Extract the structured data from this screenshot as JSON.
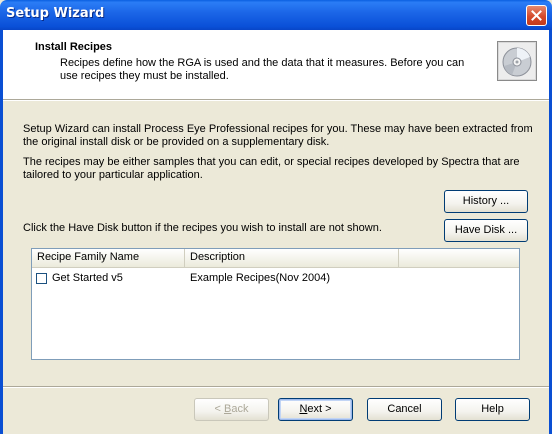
{
  "window": {
    "title": "Setup Wizard"
  },
  "header": {
    "title": "Install Recipes",
    "description": "Recipes define how the RGA is used and the data that it measures.  Before you can use recipes they must be installed."
  },
  "body": {
    "para1": "Setup Wizard can install Process Eye Professional recipes for you.  These may have been extracted from the original install disk or be provided on a supplementary disk.",
    "para2": "The recipes may be either samples that you can edit, or special recipes developed by Spectra that are tailored to your particular application.",
    "para3": "Click the Have Disk button if the recipes you wish to install are not shown."
  },
  "buttons": {
    "history": "History ...",
    "have_disk": "Have Disk ...",
    "back_prefix": "< ",
    "back_key": "B",
    "back_rest": "ack",
    "next_key": "N",
    "next_rest": "ext >",
    "cancel": "Cancel",
    "help": "Help"
  },
  "recipes_table": {
    "columns": [
      "Recipe Family Name",
      "Description"
    ],
    "rows": [
      {
        "name": "Get Started v5",
        "description": "Example Recipes(Nov 2004)",
        "checked": false
      }
    ]
  },
  "colors": {
    "titlebar": "#0A50D8",
    "close": "#D54A2C",
    "dialog_bg": "#ECE9D8"
  },
  "icons": {
    "header_icon": "cd-disc-icon",
    "close_icon": "close-x-icon"
  }
}
